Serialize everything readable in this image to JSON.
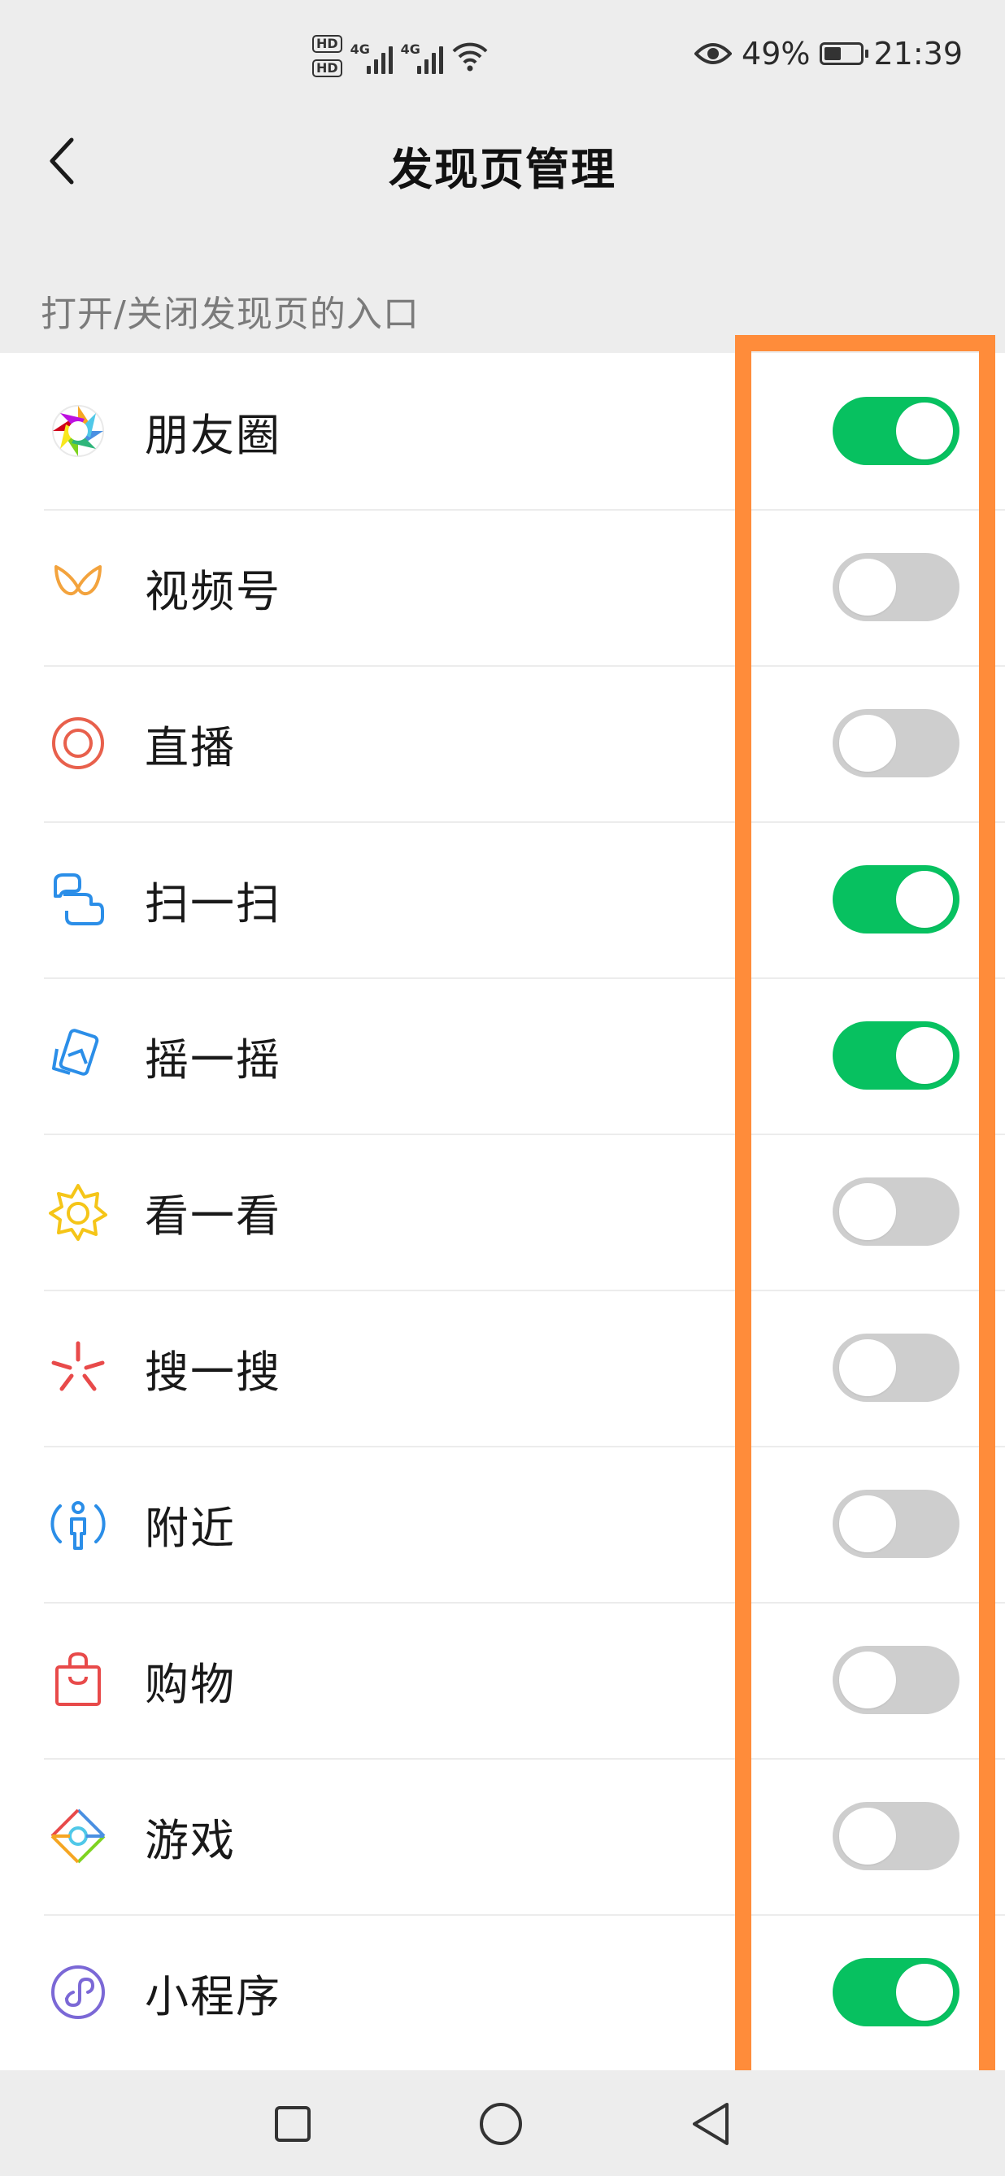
{
  "status_bar": {
    "hd1": "HD",
    "hd2": "HD",
    "net1": "4G",
    "net2": "4G",
    "battery_percent": "49%",
    "time": "21:39"
  },
  "nav": {
    "title": "发现页管理"
  },
  "section": {
    "label": "打开/关闭发现页的入口"
  },
  "colors": {
    "toggle_on": "#07c160",
    "toggle_off": "#cecece",
    "highlight": "#ff8c3a"
  },
  "items": [
    {
      "label": "朋友圈",
      "icon": "moments-icon",
      "on": true
    },
    {
      "label": "视频号",
      "icon": "channels-icon",
      "on": false
    },
    {
      "label": "直播",
      "icon": "live-icon",
      "on": false
    },
    {
      "label": "扫一扫",
      "icon": "scan-icon",
      "on": true
    },
    {
      "label": "摇一摇",
      "icon": "shake-icon",
      "on": true
    },
    {
      "label": "看一看",
      "icon": "top-stories-icon",
      "on": false
    },
    {
      "label": "搜一搜",
      "icon": "search-icon",
      "on": false
    },
    {
      "label": "附近",
      "icon": "nearby-icon",
      "on": false
    },
    {
      "label": "购物",
      "icon": "shopping-bag-icon",
      "on": false
    },
    {
      "label": "游戏",
      "icon": "games-icon",
      "on": false
    },
    {
      "label": "小程序",
      "icon": "mini-programs-icon",
      "on": true
    }
  ]
}
